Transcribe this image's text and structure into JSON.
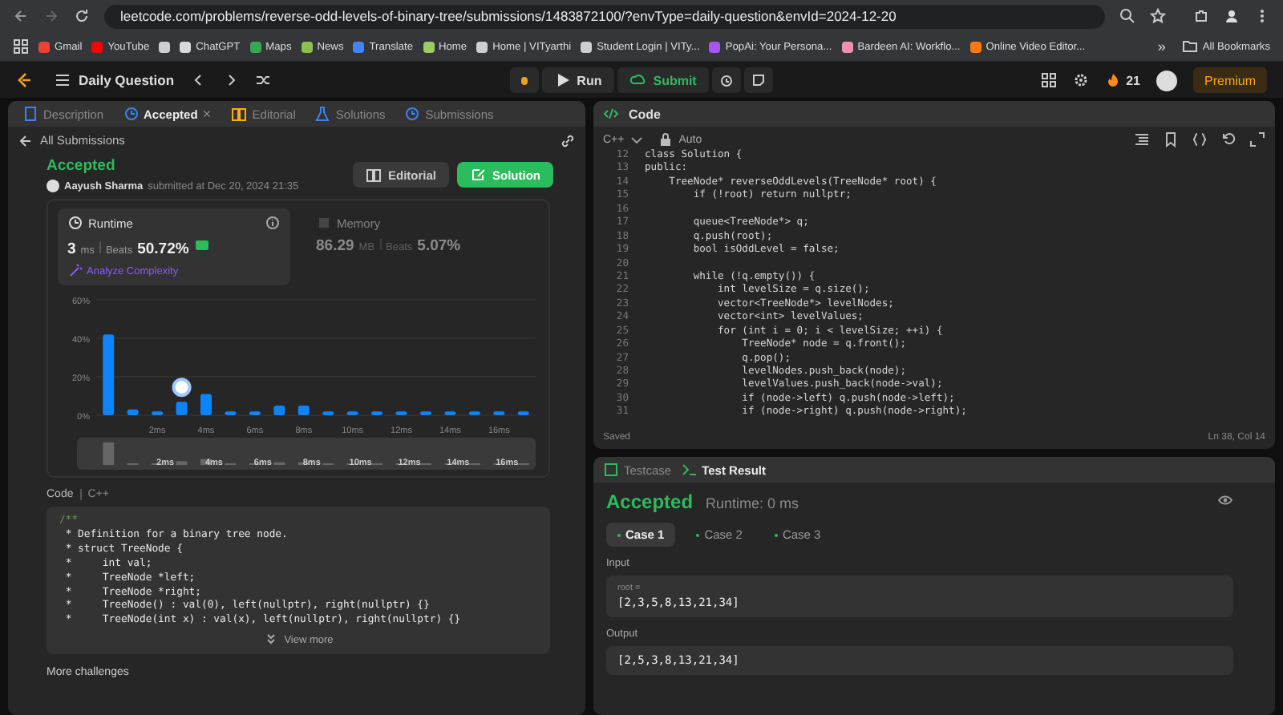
{
  "browser": {
    "url": "leetcode.com/problems/reverse-odd-levels-of-binary-tree/submissions/1483872100/?envType=daily-question&envId=2024-12-20",
    "bookmarks": [
      {
        "label": "Gmail",
        "color": "#ea4335"
      },
      {
        "label": "YouTube",
        "color": "#ff0000"
      },
      {
        "color": "#cfcfcf"
      },
      {
        "label": "ChatGPT",
        "color": "#d9d9d9"
      },
      {
        "label": "Maps",
        "color": "#34a853"
      },
      {
        "label": "News",
        "color": "#8bc34a"
      },
      {
        "label": "Translate",
        "color": "#4285f4"
      },
      {
        "label": "Home",
        "color": "#9ccc65"
      },
      {
        "label": "Home | VITyarthi",
        "color": "#cfcfcf"
      },
      {
        "label": "Student Login | VITy...",
        "color": "#cfcfcf"
      },
      {
        "label": "PopAi: Your Persona...",
        "color": "#a855f7"
      },
      {
        "label": "Bardeen AI: Workflo...",
        "color": "#f48fb1"
      },
      {
        "label": "Online Video Editor...",
        "color": "#ff7a00"
      }
    ],
    "more": "»",
    "all_bookmarks": "All Bookmarks"
  },
  "toolbar": {
    "title": "Daily Question",
    "run": "Run",
    "submit": "Submit",
    "streak": "21",
    "premium": "Premium"
  },
  "left": {
    "tabs": [
      {
        "label": "Description",
        "selected": false,
        "closable": false
      },
      {
        "label": "Accepted",
        "selected": true,
        "closable": true
      },
      {
        "label": "Editorial",
        "selected": false,
        "closable": false
      },
      {
        "label": "Solutions",
        "selected": false,
        "closable": false
      },
      {
        "label": "Submissions",
        "selected": false,
        "closable": false
      }
    ],
    "back": "All Submissions",
    "status": "Accepted",
    "author": "Aayush Sharma",
    "submitted": "submitted at Dec 20, 2024 21:35",
    "editorial_button": "Editorial",
    "solution_button": "Solution",
    "metrics": [
      {
        "kind": "runtime",
        "label": "Runtime",
        "value": "3",
        "unit": "ms",
        "beats_label": "Beats",
        "beats": "50.72%",
        "selected": true,
        "link": "Analyze Complexity"
      },
      {
        "kind": "memory",
        "label": "Memory",
        "value": "86.29",
        "unit": "MB",
        "beats_label": "Beats",
        "beats": "5.07%",
        "selected": false
      }
    ],
    "chart_data": {
      "type": "bar",
      "x": [
        0,
        1,
        2,
        3,
        4,
        5,
        6,
        7,
        8,
        9,
        10,
        11,
        12,
        13,
        14,
        15,
        16,
        17
      ],
      "values": [
        42,
        3,
        2,
        7,
        11,
        2,
        2,
        5,
        5,
        2,
        2,
        2,
        2,
        2,
        2,
        2,
        2,
        2
      ],
      "xlim": [
        -0.5,
        17.5
      ],
      "ylim": [
        0,
        60
      ],
      "yticks": [
        {
          "value": 0,
          "label": "0%"
        },
        {
          "value": 20,
          "label": "20%"
        },
        {
          "value": 40,
          "label": "40%"
        },
        {
          "value": 60,
          "label": "60%"
        }
      ],
      "xticks": [
        {
          "value": 2,
          "label": "2ms"
        },
        {
          "value": 4,
          "label": "4ms"
        },
        {
          "value": 6,
          "label": "6ms"
        },
        {
          "value": 8,
          "label": "8ms"
        },
        {
          "value": 10,
          "label": "10ms"
        },
        {
          "value": 12,
          "label": "12ms"
        },
        {
          "value": 14,
          "label": "14ms"
        },
        {
          "value": 16,
          "label": "16ms"
        }
      ]
    },
    "navigator": {
      "labels": [
        "2ms",
        "4ms",
        "6ms",
        "8ms",
        "10ms",
        "12ms",
        "14ms",
        "16ms"
      ]
    },
    "code_label": "Code",
    "code_language": "C++",
    "code_lines": [
      "/**",
      " * Definition for a binary tree node.",
      " * struct TreeNode {",
      " *     int val;",
      " *     TreeNode *left;",
      " *     TreeNode *right;",
      " *     TreeNode() : val(0), left(nullptr), right(nullptr) {}",
      " *     TreeNode(int x) : val(x), left(nullptr), right(nullptr) {}"
    ],
    "view_more": "View more",
    "more_challenges": "More challenges"
  },
  "editor": {
    "title": "Code",
    "language": "C++",
    "mode": "Auto",
    "lines": [
      {
        "n": "12",
        "text": "class Solution {"
      },
      {
        "n": "13",
        "text": "public:"
      },
      {
        "n": "14",
        "text": "    TreeNode* reverseOddLevels(TreeNode* root) {"
      },
      {
        "n": "15",
        "text": "        if (!root) return nullptr;"
      },
      {
        "n": "16"
      },
      {
        "n": "17",
        "text": "        queue<TreeNode*> q;"
      },
      {
        "n": "18",
        "text": "        q.push(root);"
      },
      {
        "n": "19",
        "text": "        bool isOddLevel = false;"
      },
      {
        "n": "20"
      },
      {
        "n": "21",
        "text": "        while (!q.empty()) {"
      },
      {
        "n": "22",
        "text": "            int levelSize = q.size();"
      },
      {
        "n": "23",
        "text": "            vector<TreeNode*> levelNodes;"
      },
      {
        "n": "24",
        "text": "            vector<int> levelValues;"
      },
      {
        "n": "25",
        "text": "            for (int i = 0; i < levelSize; ++i) {"
      },
      {
        "n": "26",
        "text": "                TreeNode* node = q.front();"
      },
      {
        "n": "27",
        "text": "                q.pop();"
      },
      {
        "n": "28",
        "text": "                levelNodes.push_back(node);"
      },
      {
        "n": "29",
        "text": "                levelValues.push_back(node->val);"
      },
      {
        "n": "30",
        "text": "                if (node->left) q.push(node->left);"
      },
      {
        "n": "31",
        "text": "                if (node->right) q.push(node->right);"
      }
    ],
    "status": "Saved",
    "cursor": "Ln 38, Col 14"
  },
  "tests": {
    "tabs": [
      {
        "label": "Testcase",
        "selected": false
      },
      {
        "label": "Test Result",
        "selected": true
      }
    ],
    "status": "Accepted",
    "runtime": "Runtime: 0 ms",
    "cases": [
      {
        "label": "Case 1",
        "selected": true
      },
      {
        "label": "Case 2",
        "selected": false
      },
      {
        "label": "Case 3",
        "selected": false
      }
    ],
    "input_label": "Input",
    "input_var": "root =",
    "input_value": "[2,3,5,8,13,21,34]",
    "output_label": "Output",
    "output_value": "[2,5,3,8,13,21,34]"
  }
}
